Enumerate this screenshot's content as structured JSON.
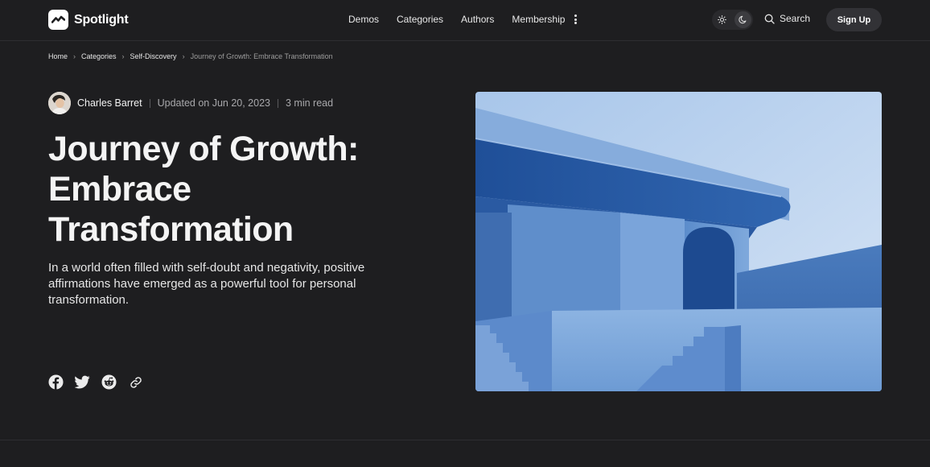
{
  "brand": {
    "name": "Spotlight"
  },
  "nav": {
    "items": [
      "Demos",
      "Categories",
      "Authors",
      "Membership"
    ],
    "search_label": "Search",
    "signup_label": "Sign Up"
  },
  "breadcrumb": {
    "items": [
      "Home",
      "Categories",
      "Self-Discovery"
    ],
    "current": "Journey of Growth: Embrace Transformation"
  },
  "article": {
    "author": "Charles Barret",
    "updated": "Updated on Jun 20, 2023",
    "read_time": "3 min read",
    "title": "Journey of Growth: Embrace Transformation",
    "subtitle": "In a world often filled with self-doubt and negativity, positive affirmations have emerged as a powerful tool for personal transformation."
  },
  "share": {
    "icons": [
      "facebook-icon",
      "twitter-icon",
      "reddit-icon",
      "link-icon"
    ]
  },
  "colors": {
    "background": "#1e1e20",
    "text": "#f2f2f2",
    "muted": "#a8a8ab",
    "hero_blue": "#3f6fb0"
  }
}
